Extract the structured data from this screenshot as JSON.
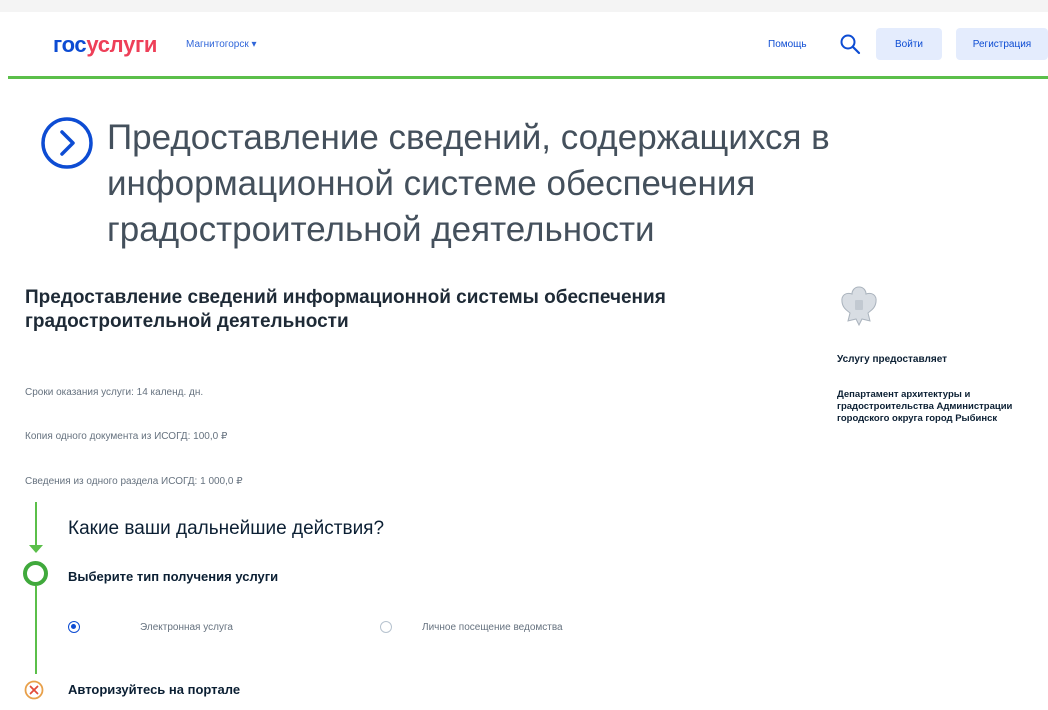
{
  "header": {
    "logo_part1": "гос",
    "logo_part2": "услуги",
    "city": "Магнитогорск ▾",
    "help": "Помощь",
    "login_button": "Войти",
    "register_button": "Регистрация",
    "icons": {
      "search": "search-icon"
    }
  },
  "page": {
    "title": "Предоставление сведений, содержащихся в информационной системе обеспечения градостроительной деятельности",
    "title_icon": "chevron-right-circle-icon"
  },
  "service": {
    "name": "Предоставление сведений информационной системы обеспечения градостроительной деятельности",
    "info": [
      "Сроки оказания услуги: 14 календ. дн.",
      "Копия одного документа из ИСОГД: 100,0 ₽",
      "Сведения из одного раздела ИСОГД: 1 000,0 ₽"
    ]
  },
  "provider": {
    "emblem_icon": "coat-of-arms-icon",
    "label": "Услугу предоставляет",
    "name": "Департамент архитектуры и градостроительства Администрации городского округа город Рыбинск"
  },
  "steps": {
    "question": "Какие ваши дальнейшие действия?",
    "step1": {
      "label": "Выберите тип получения услуги",
      "options": [
        {
          "label": "Электронная услуга",
          "checked": true
        },
        {
          "label": "Личное посещение ведомства",
          "checked": false
        }
      ]
    },
    "step2": {
      "label": "Авторизуйтесь на портале",
      "icon": "close-circle-icon"
    }
  },
  "colors": {
    "brand_blue": "#0d4cd3",
    "brand_red": "#ee3f58",
    "green": "#5bbf4a",
    "warning_orange": "#e8a04a"
  }
}
